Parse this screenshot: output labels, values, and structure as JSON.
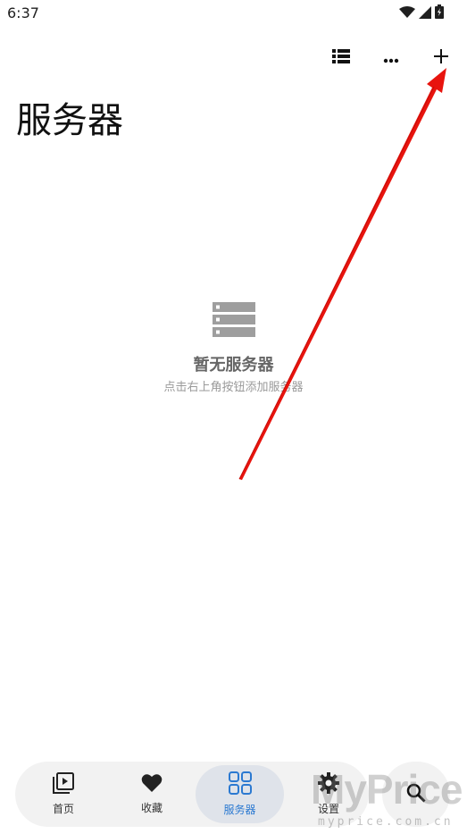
{
  "status_bar": {
    "time": "6:37",
    "icons": [
      "wifi-icon",
      "signal-icon",
      "battery-icon"
    ]
  },
  "toolbar": {
    "actions": [
      {
        "name": "list-view-icon"
      },
      {
        "name": "more-icon"
      },
      {
        "name": "add-icon"
      }
    ]
  },
  "page": {
    "title": "服务器"
  },
  "empty_state": {
    "icon": "server-icon",
    "title": "暂无服务器",
    "hint": "点击右上角按钮添加服务器"
  },
  "bottom_nav": {
    "items": [
      {
        "label": "首页",
        "icon": "play-library-icon",
        "active": false
      },
      {
        "label": "收藏",
        "icon": "heart-icon",
        "active": false
      },
      {
        "label": "服务器",
        "icon": "grid-icon",
        "active": true
      },
      {
        "label": "设置",
        "icon": "gear-icon",
        "active": false
      }
    ],
    "search_icon": "search-icon"
  },
  "watermark": {
    "text": "MyPrice",
    "sub": "myprice.com.cn"
  },
  "colors": {
    "accent": "#2b79d1",
    "annotation_arrow": "#e8140e",
    "nav_background": "#f2f2f2",
    "nav_active_background": "#dfe3ea"
  }
}
